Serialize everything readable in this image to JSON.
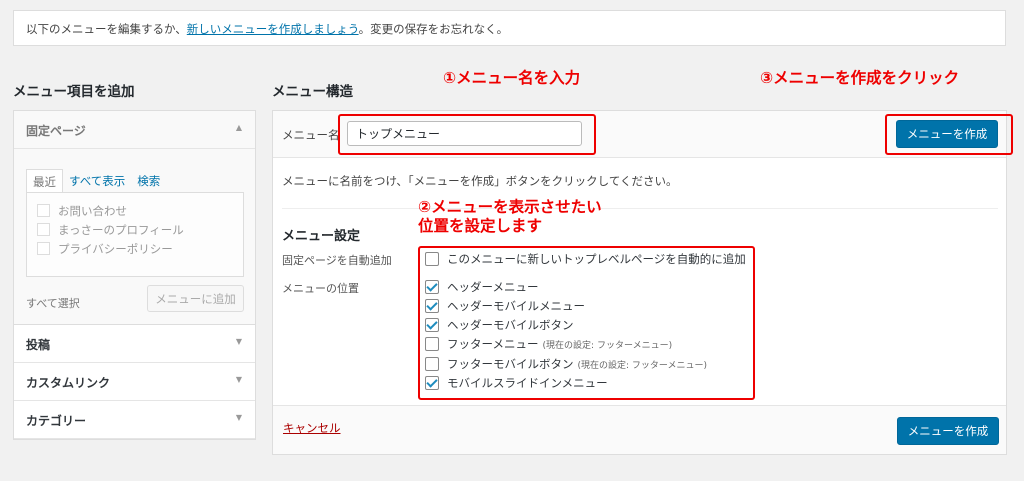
{
  "notice": {
    "before": "以下のメニューを編集するか、",
    "link": "新しいメニューを作成しましょう",
    "after": "。変更の保存をお忘れなく。"
  },
  "left": {
    "title": "メニュー項目を追加",
    "fixed_pages": {
      "label": "固定ページ",
      "tabs": [
        "最近",
        "すべて表示",
        "検索"
      ],
      "items": [
        "お問い合わせ",
        "まっさーのプロフィール",
        "プライバシーポリシー"
      ],
      "select_all": "すべて選択",
      "add_button": "メニューに追加"
    },
    "sections": [
      "投稿",
      "カスタムリンク",
      "カテゴリー"
    ]
  },
  "right": {
    "title": "メニュー構造",
    "menu_name_label": "メニュー名",
    "menu_name_value": "トップメニュー",
    "create_button": "メニューを作成",
    "instructions": "メニューに名前をつけ、「メニューを作成」ボタンをクリックしてください。",
    "settings_title": "メニュー設定",
    "auto_add_label": "固定ページを自動追加",
    "auto_add_option": "このメニューに新しいトップレベルページを自動的に追加",
    "location_label": "メニューの位置",
    "locations": [
      {
        "label": "ヘッダーメニュー",
        "note": "",
        "checked": true
      },
      {
        "label": "ヘッダーモバイルメニュー",
        "note": "",
        "checked": true
      },
      {
        "label": "ヘッダーモバイルボタン",
        "note": "",
        "checked": true
      },
      {
        "label": "フッターメニュー",
        "note": "(現在の設定: フッターメニュー)",
        "checked": false
      },
      {
        "label": "フッターモバイルボタン",
        "note": "(現在の設定: フッターメニュー)",
        "checked": false
      },
      {
        "label": "モバイルスライドインメニュー",
        "note": "",
        "checked": true
      }
    ],
    "cancel": "キャンセル"
  },
  "annotations": {
    "a1": "①メニュー名を入力",
    "a2_line1": "②メニューを表示させたい",
    "a2_line2": "位置を設定します",
    "a3": "③メニューを作成をクリック"
  },
  "colors": {
    "accent": "#0073aa",
    "annotation": "#e00000",
    "check": "#1e8cbe"
  }
}
